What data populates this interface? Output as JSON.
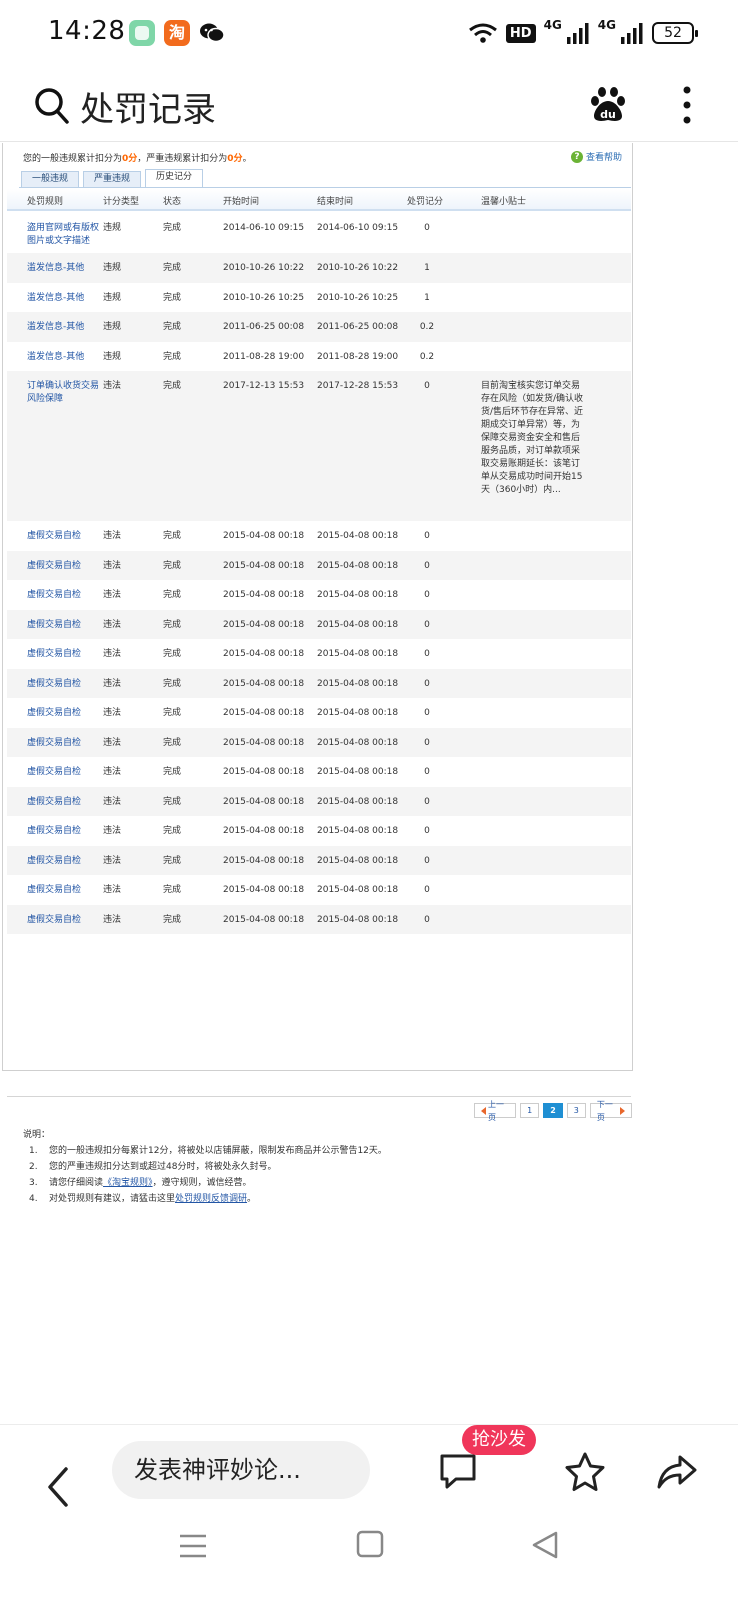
{
  "status_bar": {
    "time": "14:28",
    "taobao_glyph": "淘",
    "hd_label": "HD",
    "signal1_label": "4G",
    "signal2_label": "4G",
    "battery": "52"
  },
  "title_bar": {
    "title": "处罚记录",
    "icons": [
      "search-icon",
      "baidu-logo",
      "more-vertical-icon"
    ]
  },
  "page": {
    "summary": {
      "prefix": "您的一般违规累计扣分为",
      "general_points": "0分",
      "middle": "，严重违规累计扣分为",
      "serious_points": "0分",
      "suffix": "。"
    },
    "help_icon": "?",
    "help_label": "查看帮助",
    "tabs": [
      {
        "label": "一般违规",
        "active": false
      },
      {
        "label": "严重违规",
        "active": false
      },
      {
        "label": "历史记分",
        "active": true
      }
    ],
    "columns": {
      "rule": "处罚规则",
      "type": "计分类型",
      "status": "状态",
      "start": "开始时间",
      "end": "结束时间",
      "points": "处罚记分",
      "tip": "温馨小贴士"
    },
    "rows": [
      {
        "rule": "盗用官网或有版权图片或文字描述",
        "type": "违规",
        "status": "完成",
        "start": "2014-06-10 09:15",
        "end": "2014-06-10 09:15",
        "points": "0",
        "tip": ""
      },
      {
        "rule": "滥发信息-其他",
        "type": "违规",
        "status": "完成",
        "start": "2010-10-26 10:22",
        "end": "2010-10-26 10:22",
        "points": "1",
        "tip": ""
      },
      {
        "rule": "滥发信息-其他",
        "type": "违规",
        "status": "完成",
        "start": "2010-10-26 10:25",
        "end": "2010-10-26 10:25",
        "points": "1",
        "tip": ""
      },
      {
        "rule": "滥发信息-其他",
        "type": "违规",
        "status": "完成",
        "start": "2011-06-25 00:08",
        "end": "2011-06-25 00:08",
        "points": "0.2",
        "tip": ""
      },
      {
        "rule": "滥发信息-其他",
        "type": "违规",
        "status": "完成",
        "start": "2011-08-28 19:00",
        "end": "2011-08-28 19:00",
        "points": "0.2",
        "tip": ""
      },
      {
        "rule": "订单确认收货交易风险保障",
        "type": "违法",
        "status": "完成",
        "start": "2017-12-13 15:53",
        "end": "2017-12-28 15:53",
        "points": "0",
        "tip": "目前淘宝核实您订单交易存在风险（如发货/确认收货/售后环节存在异常、近期成交订单异常）等，为保障交易资金安全和售后服务品质，对订单款项采取交易账期延长：该笔订单从交易成功时间开始15天（360小时）内..."
      },
      {
        "rule": "虚假交易自检",
        "type": "违法",
        "status": "完成",
        "start": "2015-04-08 00:18",
        "end": "2015-04-08 00:18",
        "points": "0",
        "tip": ""
      },
      {
        "rule": "虚假交易自检",
        "type": "违法",
        "status": "完成",
        "start": "2015-04-08 00:18",
        "end": "2015-04-08 00:18",
        "points": "0",
        "tip": ""
      },
      {
        "rule": "虚假交易自检",
        "type": "违法",
        "status": "完成",
        "start": "2015-04-08 00:18",
        "end": "2015-04-08 00:18",
        "points": "0",
        "tip": ""
      },
      {
        "rule": "虚假交易自检",
        "type": "违法",
        "status": "完成",
        "start": "2015-04-08 00:18",
        "end": "2015-04-08 00:18",
        "points": "0",
        "tip": ""
      },
      {
        "rule": "虚假交易自检",
        "type": "违法",
        "status": "完成",
        "start": "2015-04-08 00:18",
        "end": "2015-04-08 00:18",
        "points": "0",
        "tip": ""
      },
      {
        "rule": "虚假交易自检",
        "type": "违法",
        "status": "完成",
        "start": "2015-04-08 00:18",
        "end": "2015-04-08 00:18",
        "points": "0",
        "tip": ""
      },
      {
        "rule": "虚假交易自检",
        "type": "违法",
        "status": "完成",
        "start": "2015-04-08 00:18",
        "end": "2015-04-08 00:18",
        "points": "0",
        "tip": ""
      },
      {
        "rule": "虚假交易自检",
        "type": "违法",
        "status": "完成",
        "start": "2015-04-08 00:18",
        "end": "2015-04-08 00:18",
        "points": "0",
        "tip": ""
      },
      {
        "rule": "虚假交易自检",
        "type": "违法",
        "status": "完成",
        "start": "2015-04-08 00:18",
        "end": "2015-04-08 00:18",
        "points": "0",
        "tip": ""
      },
      {
        "rule": "虚假交易自检",
        "type": "违法",
        "status": "完成",
        "start": "2015-04-08 00:18",
        "end": "2015-04-08 00:18",
        "points": "0",
        "tip": ""
      },
      {
        "rule": "虚假交易自检",
        "type": "违法",
        "status": "完成",
        "start": "2015-04-08 00:18",
        "end": "2015-04-08 00:18",
        "points": "0",
        "tip": ""
      },
      {
        "rule": "虚假交易自检",
        "type": "违法",
        "status": "完成",
        "start": "2015-04-08 00:18",
        "end": "2015-04-08 00:18",
        "points": "0",
        "tip": ""
      },
      {
        "rule": "虚假交易自检",
        "type": "违法",
        "status": "完成",
        "start": "2015-04-08 00:18",
        "end": "2015-04-08 00:18",
        "points": "0",
        "tip": ""
      },
      {
        "rule": "虚假交易自检",
        "type": "违法",
        "status": "完成",
        "start": "2015-04-08 00:18",
        "end": "2015-04-08 00:18",
        "points": "0",
        "tip": ""
      }
    ],
    "pagination": {
      "prev": "上一页",
      "pages": [
        "1",
        "2",
        "3"
      ],
      "current": "2",
      "next": "下一页"
    },
    "notes_title": "说明：",
    "notes": [
      {
        "num": "1.",
        "text": "您的一般违规扣分每累计12分，将被处以店铺屏蔽，限制发布商品并公示警告12天。"
      },
      {
        "num": "2.",
        "text": "您的严重违规扣分达到或超过48分时，将被处永久封号。"
      },
      {
        "num": "3.",
        "pre": "请您仔细阅读",
        "link": "《淘宝规则》",
        "post": "，遵守规则，诚信经营。"
      },
      {
        "num": "4.",
        "pre": "对处罚规则有建议，请猛击这里",
        "link": "处罚规则反馈调研",
        "post": "。"
      }
    ]
  },
  "bottom_bar": {
    "comment_placeholder": "发表神评妙论...",
    "badge": "抢沙发",
    "icons": [
      "back-icon",
      "comment-icon",
      "star-icon",
      "share-icon"
    ]
  },
  "nav_bar": {
    "icons": [
      "menu-icon",
      "home-icon",
      "back-triangle-icon"
    ]
  },
  "colors": {
    "link": "#2356a5",
    "highlight": "#ff6600",
    "badge": "#f0365a",
    "row_alt": "#f4f4f4"
  }
}
